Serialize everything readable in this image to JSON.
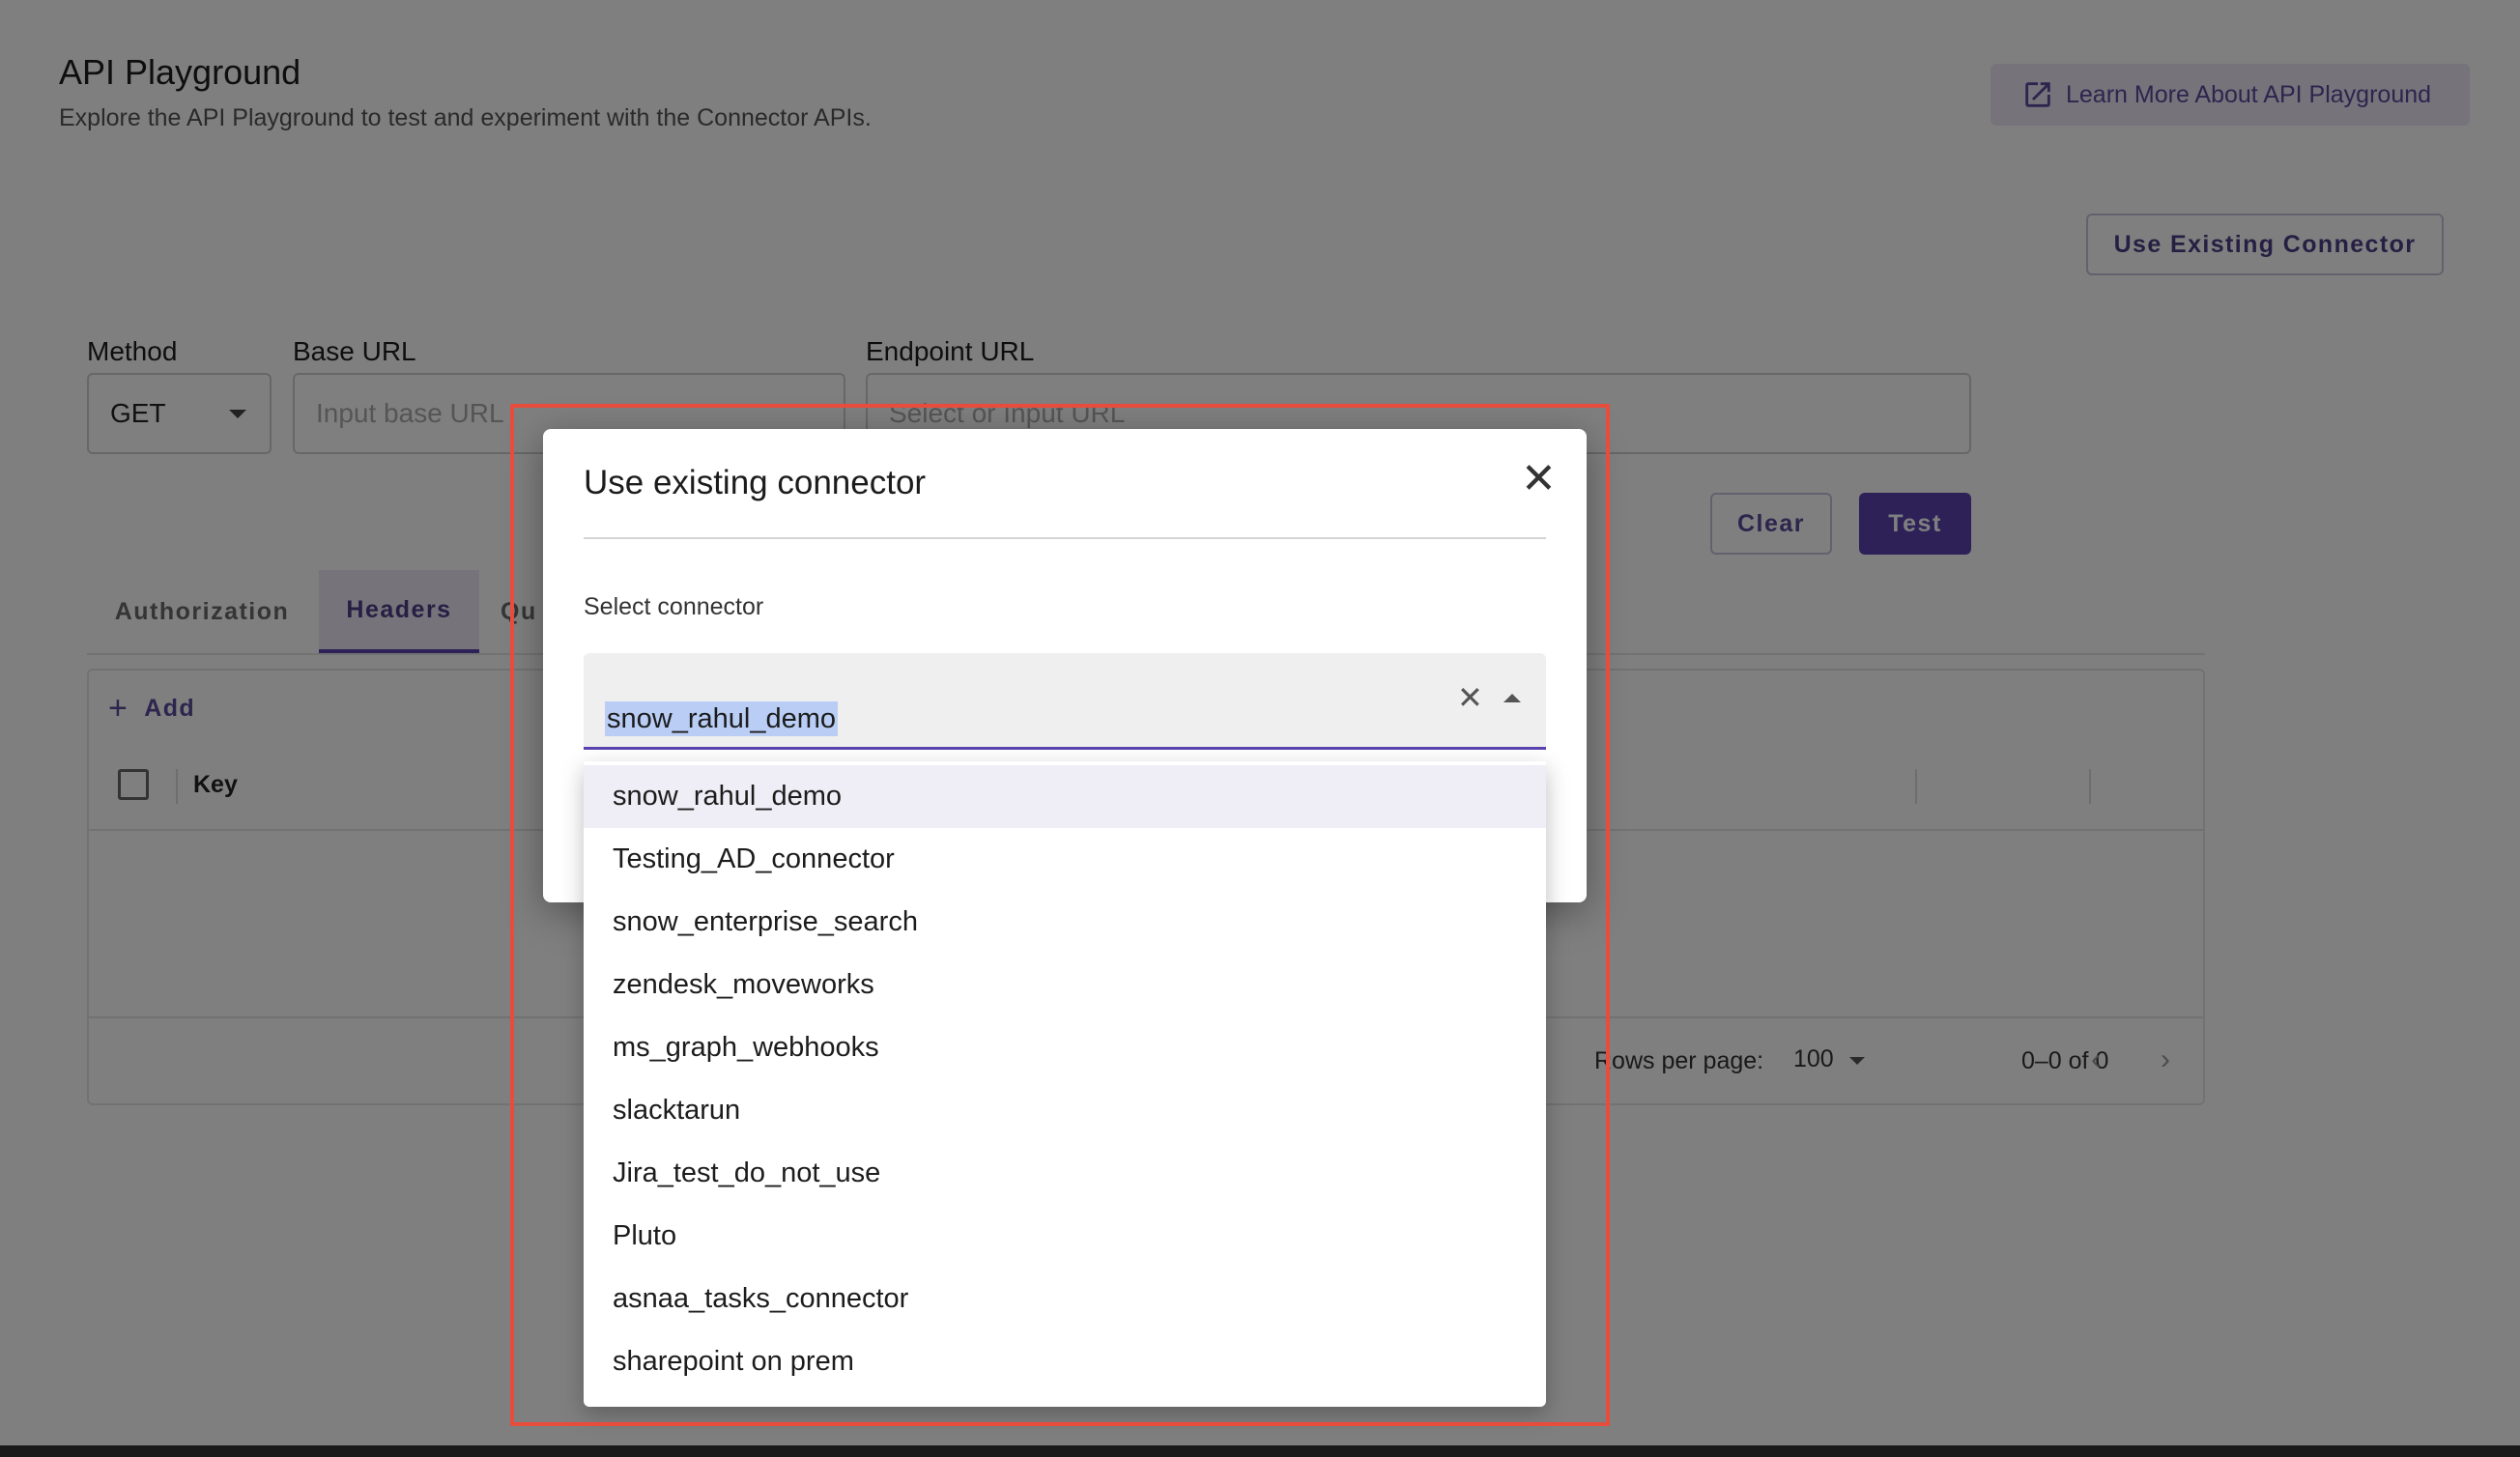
{
  "page": {
    "title": "API Playground",
    "subtitle": "Explore the API Playground to test and experiment with the Connector APIs.",
    "learn_more_label": "Learn More About API Playground",
    "use_existing_label": "Use Existing Connector"
  },
  "form": {
    "method_label": "Method",
    "method_value": "GET",
    "base_url_label": "Base URL",
    "base_url_placeholder": "Input base URL",
    "endpoint_label": "Endpoint URL",
    "endpoint_placeholder": "Select or Input URL",
    "clear_label": "Clear",
    "test_label": "Test"
  },
  "tabs": {
    "authorization": "Authorization",
    "headers": "Headers",
    "query": "Qu"
  },
  "table": {
    "add_label": "Add",
    "key_header": "Key",
    "rows_per_page_label": "Rows per page:",
    "rows_per_page_value": "100",
    "range_label": "0–0 of 0"
  },
  "modal": {
    "title": "Use existing connector",
    "select_label": "Select connector",
    "selected_value": "snow_rahul_demo",
    "options": [
      "snow_rahul_demo",
      "Testing_AD_connector",
      "snow_enterprise_search",
      "zendesk_moveworks",
      "ms_graph_webhooks",
      "slacktarun",
      "Jira_test_do_not_use",
      "Pluto",
      "asnaa_tasks_connector",
      "sharepoint on prem"
    ]
  },
  "colors": {
    "accent": "#5b43b0",
    "accent_light": "#ece6f7",
    "annotation_frame": "#e74c3c"
  }
}
